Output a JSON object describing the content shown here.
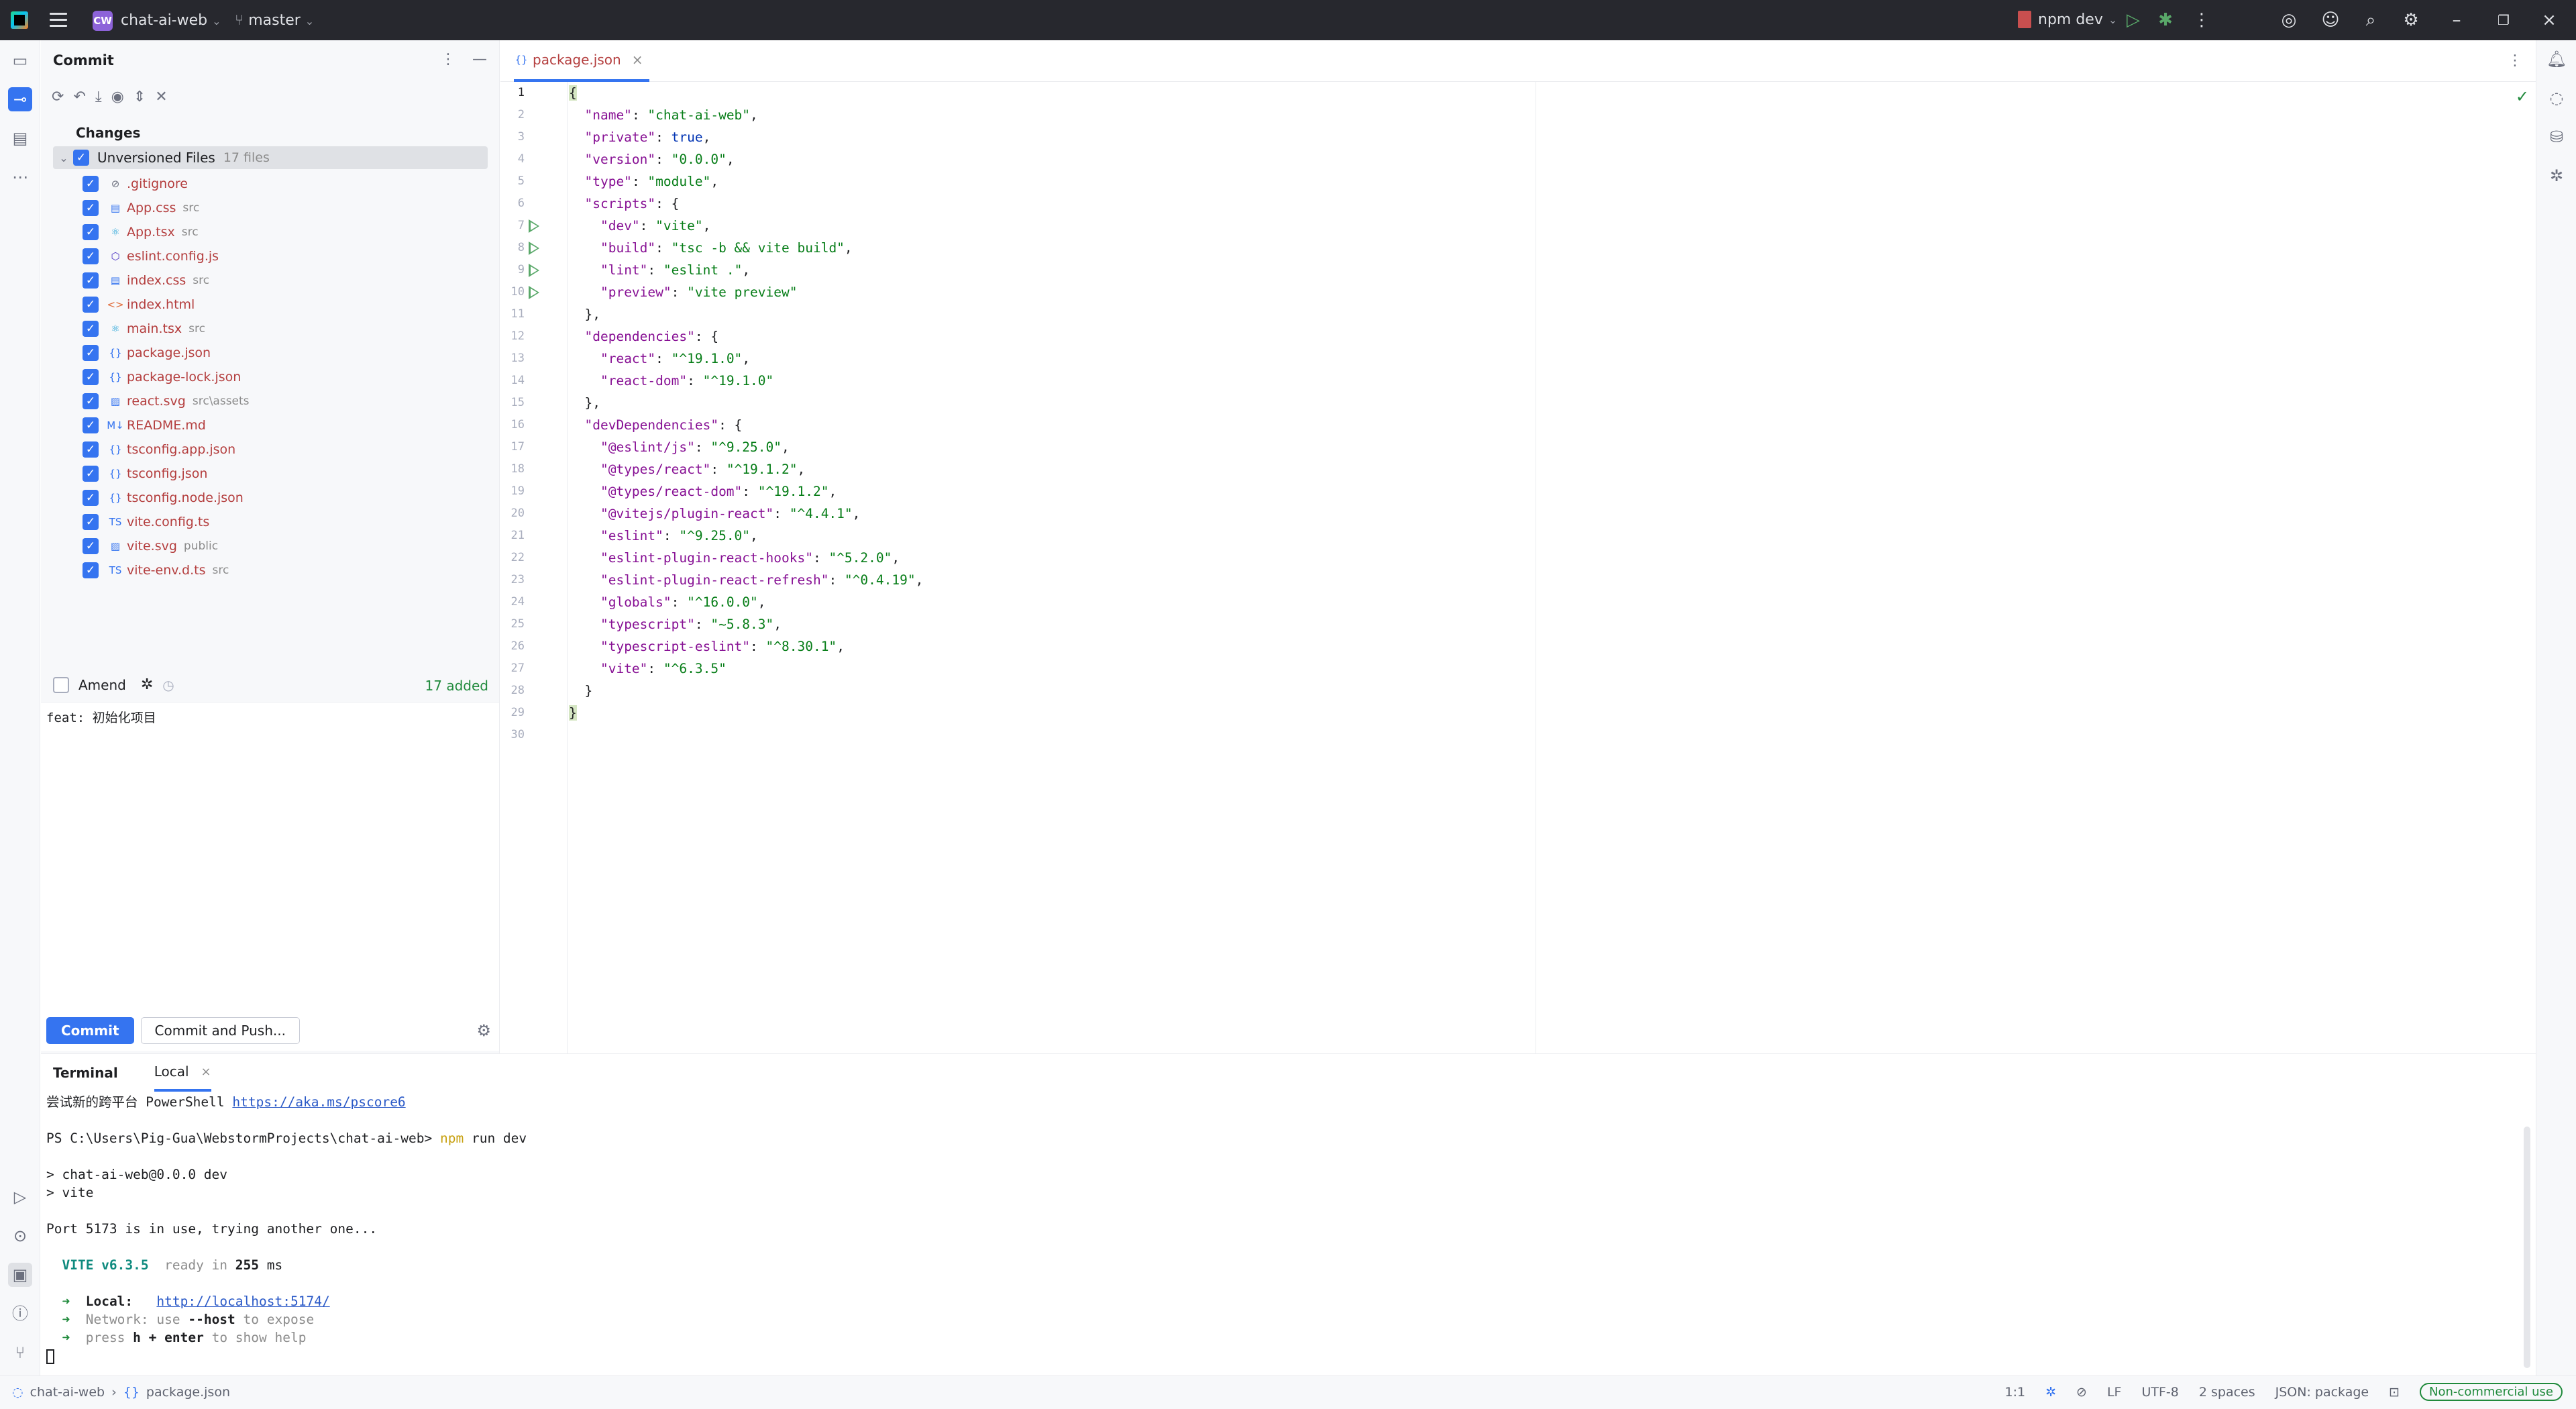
{
  "titlebar": {
    "project_badge": "CW",
    "project_name": "chat-ai-web",
    "branch": "master",
    "run_config": "npm dev"
  },
  "commit_panel": {
    "title": "Commit",
    "changes_label": "Changes",
    "group_label": "Unversioned Files",
    "group_count": "17 files",
    "files": [
      {
        "name": ".gitignore",
        "path": "",
        "icon": "ignore-icon"
      },
      {
        "name": "App.css",
        "path": "src",
        "icon": "css-icon"
      },
      {
        "name": "App.tsx",
        "path": "src",
        "icon": "react-icon"
      },
      {
        "name": "eslint.config.js",
        "path": "",
        "icon": "eslint-icon"
      },
      {
        "name": "index.css",
        "path": "src",
        "icon": "css-icon"
      },
      {
        "name": "index.html",
        "path": "",
        "icon": "html-icon"
      },
      {
        "name": "main.tsx",
        "path": "src",
        "icon": "react-icon"
      },
      {
        "name": "package.json",
        "path": "",
        "icon": "json-icon"
      },
      {
        "name": "package-lock.json",
        "path": "",
        "icon": "json-icon"
      },
      {
        "name": "react.svg",
        "path": "src\\assets",
        "icon": "image-icon"
      },
      {
        "name": "README.md",
        "path": "",
        "icon": "markdown-icon"
      },
      {
        "name": "tsconfig.app.json",
        "path": "",
        "icon": "json-icon"
      },
      {
        "name": "tsconfig.json",
        "path": "",
        "icon": "json-icon"
      },
      {
        "name": "tsconfig.node.json",
        "path": "",
        "icon": "json-icon"
      },
      {
        "name": "vite.config.ts",
        "path": "",
        "icon": "typescript-icon"
      },
      {
        "name": "vite.svg",
        "path": "public",
        "icon": "image-icon"
      },
      {
        "name": "vite-env.d.ts",
        "path": "src",
        "icon": "typescript-icon"
      }
    ],
    "amend_label": "Amend",
    "added_summary": "17 added",
    "commit_message": "feat: 初始化项目",
    "commit_button": "Commit",
    "commit_push_button": "Commit and Push..."
  },
  "editor": {
    "tab_name": "package.json",
    "lines": [
      "{",
      "  \"name\": \"chat-ai-web\",",
      "  \"private\": true,",
      "  \"version\": \"0.0.0\",",
      "  \"type\": \"module\",",
      "  \"scripts\": {",
      "    \"dev\": \"vite\",",
      "    \"build\": \"tsc -b && vite build\",",
      "    \"lint\": \"eslint .\",",
      "    \"preview\": \"vite preview\"",
      "  },",
      "  \"dependencies\": {",
      "    \"react\": \"^19.1.0\",",
      "    \"react-dom\": \"^19.1.0\"",
      "  },",
      "  \"devDependencies\": {",
      "    \"@eslint/js\": \"^9.25.0\",",
      "    \"@types/react\": \"^19.1.2\",",
      "    \"@types/react-dom\": \"^19.1.2\",",
      "    \"@vitejs/plugin-react\": \"^4.4.1\",",
      "    \"eslint\": \"^9.25.0\",",
      "    \"eslint-plugin-react-hooks\": \"^5.2.0\",",
      "    \"eslint-plugin-react-refresh\": \"^0.4.19\",",
      "    \"globals\": \"^16.0.0\",",
      "    \"typescript\": \"~5.8.3\",",
      "    \"typescript-eslint\": \"^8.30.1\",",
      "    \"vite\": \"^6.3.5\"",
      "  }",
      "}",
      ""
    ],
    "run_lines": [
      7,
      8,
      9,
      10
    ]
  },
  "terminal": {
    "title": "Terminal",
    "tab": "Local",
    "intro_text": "尝试新的跨平台 PowerShell ",
    "intro_link": "https://aka.ms/pscore6",
    "prompt": "PS C:\\Users\\Pig-Gua\\WebstormProjects\\chat-ai-web> ",
    "cmd_npm": "npm",
    "cmd_rest": " run dev",
    "out1": "> chat-ai-web@0.0.0 dev",
    "out2": "> vite",
    "out3": "Port 5173 is in use, trying another one...",
    "vite_name": "VITE v6.3.5",
    "vite_ready": "  ready in ",
    "vite_ms": "255",
    "vite_ms_unit": " ms",
    "arrow": "➜",
    "local_label": "Local:",
    "local_url": "http://localhost:5174/",
    "network_label": "Network:",
    "network_text": " use ",
    "network_flag": "--host",
    "network_tail": " to expose",
    "help_pre": " press ",
    "help_key": "h + enter",
    "help_tail": " to show help"
  },
  "statusbar": {
    "project": "chat-ai-web",
    "file": "package.json",
    "position": "1:1",
    "line_ending": "LF",
    "encoding": "UTF-8",
    "indent": "2 spaces",
    "schema": "JSON: package",
    "license": "Non-commercial use"
  }
}
